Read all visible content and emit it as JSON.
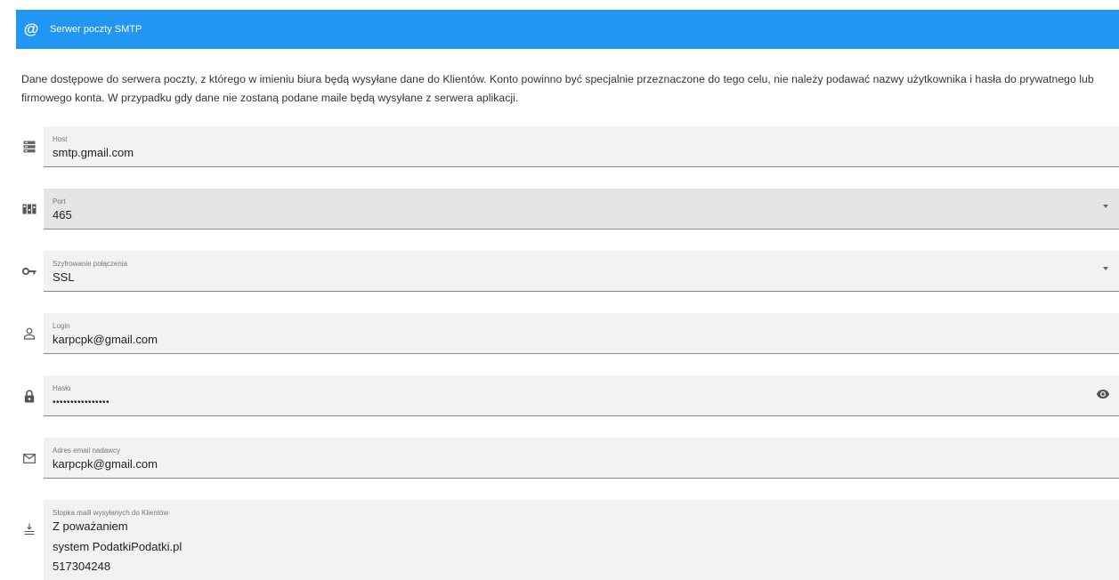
{
  "header": {
    "title": "Serwer poczty SMTP",
    "icon": "at-icon",
    "color": "#2196f3"
  },
  "description": "Dane dostępowe do serwera poczty, z którego w imieniu biura będą wysyłane dane do Klientów. Konto powinno być specjalnie przeznaczone do tego celu, nie należy podawać nazwy użytkownika i hasła do prywatnego lub firmowego konta. W przypadku gdy dane nie zostaną podane maile będą wysyłane z serwera aplikacji.",
  "fields": {
    "host": {
      "label": "Host",
      "value": "smtp.gmail.com",
      "icon": "server-icon"
    },
    "port": {
      "label": "Port",
      "value": "465",
      "icon": "port-icon"
    },
    "encryption": {
      "label": "Szyfrowanie połączenia",
      "value": "SSL",
      "icon": "key-icon"
    },
    "login": {
      "label": "Login",
      "value": "karpcpk@gmail.com",
      "icon": "person-icon"
    },
    "password": {
      "label": "Hasło",
      "value": "••••••••••••••••",
      "icon": "lock-icon"
    },
    "sender": {
      "label": "Adres email nadawcy",
      "value": "karpcpk@gmail.com",
      "icon": "envelope-icon"
    },
    "footer": {
      "label": "Stopka maili wysyłanych do Klientów",
      "lines": [
        "Z poważaniem",
        "system PodatkiPodatki.pl",
        "517304248"
      ],
      "icon": "text-footer-icon"
    }
  }
}
